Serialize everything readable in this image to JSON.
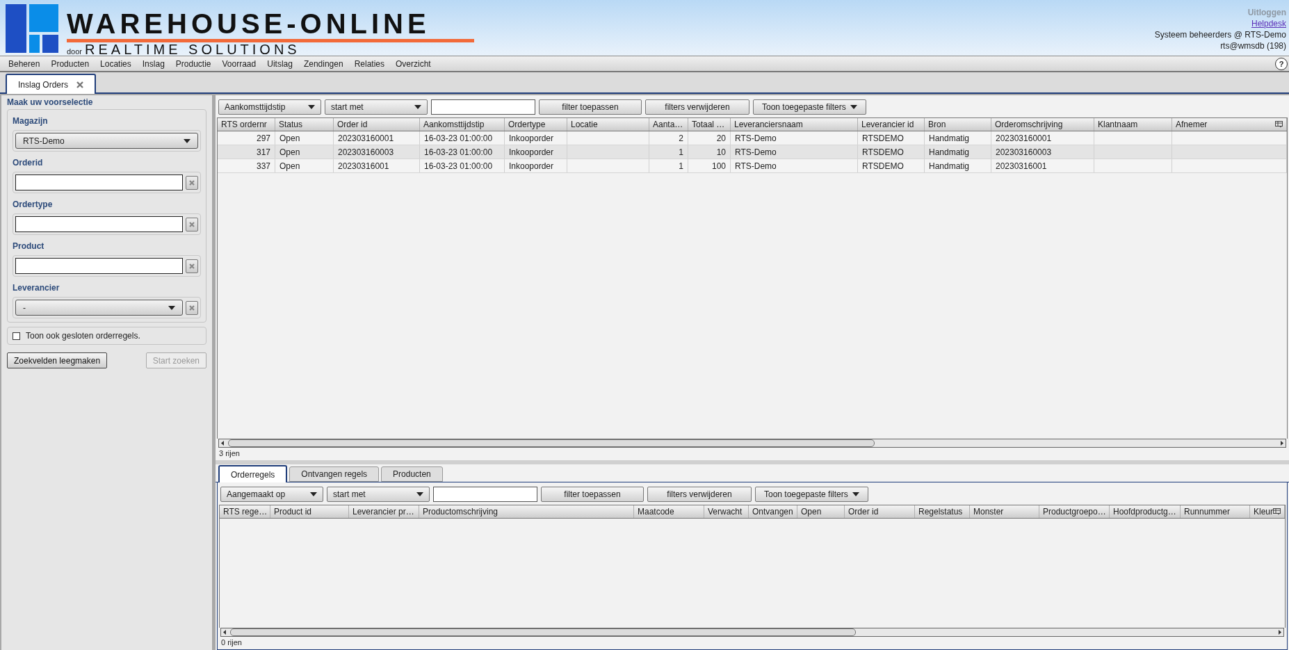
{
  "header": {
    "brand_title": "WAREHOUSE-ONLINE",
    "brand_prefix": "door",
    "brand_subtitle": "REALTIME SOLUTIONS",
    "links": [
      {
        "label": "Uitloggen",
        "disabled": true
      },
      {
        "label": "Helpdesk",
        "disabled": false
      }
    ],
    "user_group": "Systeem beheerders @ RTS-Demo",
    "user_db": "rts@wmsdb (198)"
  },
  "menu": [
    "Beheren",
    "Producten",
    "Locaties",
    "Inslag",
    "Productie",
    "Voorraad",
    "Uitslag",
    "Zendingen",
    "Relaties",
    "Overzicht"
  ],
  "help_button": "?",
  "page_tabs": [
    {
      "label": "Inslag Orders",
      "selected": true
    }
  ],
  "preselection": {
    "title": "Maak uw voorselectie",
    "fields": [
      {
        "kind": "select",
        "label": "Magazijn",
        "value": "RTS-Demo",
        "clearable": false
      },
      {
        "kind": "text",
        "label": "Orderid",
        "clearable": true
      },
      {
        "kind": "text",
        "label": "Ordertype",
        "clearable": true
      },
      {
        "kind": "text",
        "label": "Product",
        "clearable": true
      },
      {
        "kind": "select",
        "label": "Leverancier",
        "value": "-",
        "clearable": true
      }
    ],
    "checkbox": {
      "label": "Toon ook gesloten orderregels.",
      "checked": false
    },
    "buttons": [
      {
        "label": "Zoekvelden leegmaken",
        "disabled": false
      },
      {
        "label": "Start zoeken",
        "disabled": true
      }
    ]
  },
  "orders_grid": {
    "filter": {
      "field": "Aankomsttijdstip",
      "operator": "start met",
      "apply_button": "filter toepassen",
      "clear_button": "filters verwijderen",
      "menu_button": "Toon toegepaste filters"
    },
    "columns": [
      "RTS ordernr",
      "Status",
      "Order id",
      "Aankomsttijdstip",
      "Ordertype",
      "Locatie",
      "Aanta…",
      "Totaal …",
      "Leveranciersnaam",
      "Leverancier id",
      "Bron",
      "Orderomschrijving",
      "Klantnaam",
      "Afnemer"
    ],
    "rows": [
      [
        "297",
        "Open",
        "202303160001",
        "16-03-23 01:00:00",
        "Inkooporder",
        "",
        "2",
        "20",
        "RTS-Demo",
        "RTSDEMO",
        "Handmatig",
        "202303160001",
        "",
        ""
      ],
      [
        "317",
        "Open",
        "202303160003",
        "16-03-23 01:00:00",
        "Inkooporder",
        "",
        "1",
        "10",
        "RTS-Demo",
        "RTSDEMO",
        "Handmatig",
        "202303160003",
        "",
        ""
      ],
      [
        "337",
        "Open",
        "20230316001",
        "16-03-23 01:00:00",
        "Inkooporder",
        "",
        "1",
        "100",
        "RTS-Demo",
        "RTSDEMO",
        "Handmatig",
        "20230316001",
        "",
        ""
      ]
    ],
    "row_count": "3 rijen"
  },
  "detail_tabs": [
    {
      "label": "Orderregels",
      "selected": true
    },
    {
      "label": "Ontvangen regels",
      "selected": false
    },
    {
      "label": "Producten",
      "selected": false
    }
  ],
  "lines_grid": {
    "filter": {
      "field": "Aangemaakt op",
      "operator": "start met",
      "apply_button": "filter toepassen",
      "clear_button": "filters verwijderen",
      "menu_button": "Toon toegepaste filters"
    },
    "columns": [
      "RTS rege…",
      "Product id",
      "Leverancier pr…",
      "Productomschrijving",
      "Maatcode",
      "Verwacht",
      "Ontvangen",
      "Open",
      "Order id",
      "Regelstatus",
      "Monster",
      "Productgroepo…",
      "Hoofdproductg…",
      "Runnummer",
      "Kleur"
    ],
    "row_count": "0 rijen"
  }
}
